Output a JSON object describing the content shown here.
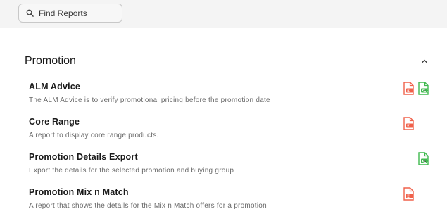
{
  "search": {
    "placeholder": "Find Reports",
    "value": ""
  },
  "section": {
    "title": "Promotion"
  },
  "reports": [
    {
      "title": "ALM Advice",
      "description": "The ALM Advice is to verify promotional pricing before the promotion date",
      "formats": [
        "pdf",
        "xls"
      ]
    },
    {
      "title": "Core Range",
      "description": "A report to display core range products.",
      "formats": [
        "pdf"
      ]
    },
    {
      "title": "Promotion Details Export",
      "description": "Export the details for the selected promotion and buying group",
      "formats": [
        "xls"
      ]
    },
    {
      "title": "Promotion Mix n Match",
      "description": "A report that shows the details for the Mix n Match offers for a promotion",
      "formats": [
        "pdf"
      ]
    }
  ],
  "colors": {
    "pdf": "#f0604a",
    "xls": "#3fb94e",
    "top_bar": "#f4f4f4"
  },
  "icons": {
    "search": "search-icon",
    "collapse": "chevron-up-icon",
    "pdf": "pdf-file-icon",
    "xls": "excel-file-icon"
  }
}
